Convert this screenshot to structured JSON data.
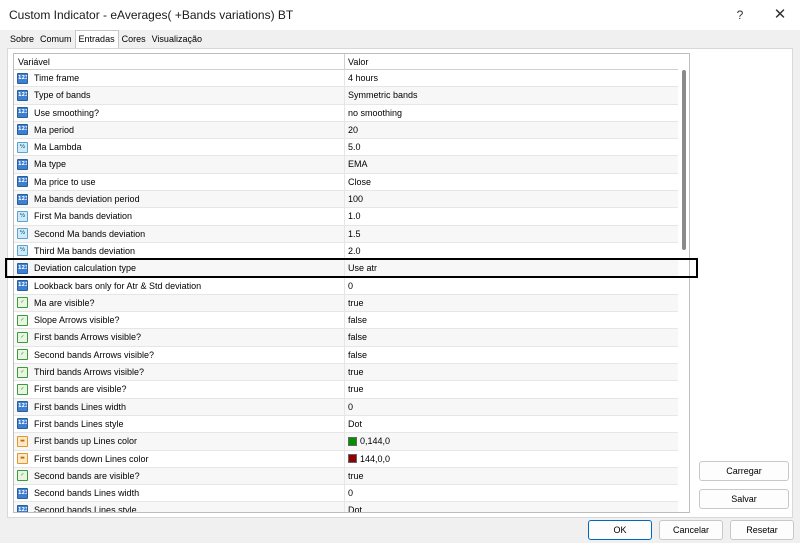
{
  "window": {
    "title": "Custom Indicator - eAverages( +Bands variations) BT",
    "help_label": "?",
    "close_label": "✕"
  },
  "tabs": [
    {
      "label": "Sobre",
      "active": false
    },
    {
      "label": "Comum",
      "active": false
    },
    {
      "label": "Entradas",
      "active": true
    },
    {
      "label": "Cores",
      "active": false
    },
    {
      "label": "Visualização",
      "active": false
    }
  ],
  "grid": {
    "col_variable": "Variável",
    "col_value": "Valor",
    "rows": [
      {
        "type": "int",
        "icon": "123",
        "name": "Time frame",
        "value": "4 hours"
      },
      {
        "type": "int",
        "icon": "123",
        "name": "Type of bands",
        "value": "Symmetric bands"
      },
      {
        "type": "int",
        "icon": "123",
        "name": "Use smoothing?",
        "value": "no smoothing"
      },
      {
        "type": "int",
        "icon": "123",
        "name": "Ma period",
        "value": "20"
      },
      {
        "type": "dbl",
        "icon": "½",
        "name": "Ma Lambda",
        "value": "5.0"
      },
      {
        "type": "int",
        "icon": "123",
        "name": "Ma type",
        "value": "EMA"
      },
      {
        "type": "int",
        "icon": "123",
        "name": "Ma price to use",
        "value": "Close"
      },
      {
        "type": "int",
        "icon": "123",
        "name": "Ma  bands deviation period",
        "value": "100"
      },
      {
        "type": "dbl",
        "icon": "½",
        "name": "First Ma bands deviation",
        "value": "1.0"
      },
      {
        "type": "dbl",
        "icon": "½",
        "name": "Second Ma bands deviation",
        "value": "1.5"
      },
      {
        "type": "dbl",
        "icon": "½",
        "name": "Third Ma bands deviation",
        "value": "2.0"
      },
      {
        "type": "int",
        "icon": "123",
        "name": "Deviation calculation type",
        "value": "Use atr"
      },
      {
        "type": "int",
        "icon": "123",
        "name": "Lookback bars only for Atr & Std deviation",
        "value": "0"
      },
      {
        "type": "bool",
        "icon": "✓",
        "name": "Ma are visible?",
        "value": "true"
      },
      {
        "type": "bool",
        "icon": "✓",
        "name": "Slope Arrows visible?",
        "value": "false"
      },
      {
        "type": "bool",
        "icon": "✓",
        "name": "First bands Arrows visible?",
        "value": "false"
      },
      {
        "type": "bool",
        "icon": "✓",
        "name": "Second bands Arrows visible?",
        "value": "false"
      },
      {
        "type": "bool",
        "icon": "✓",
        "name": "Third bands Arrows visible?",
        "value": "true"
      },
      {
        "type": "bool",
        "icon": "✓",
        "name": "First bands are visible?",
        "value": "true"
      },
      {
        "type": "int",
        "icon": "123",
        "name": "First bands Lines width",
        "value": "0"
      },
      {
        "type": "int",
        "icon": "123",
        "name": "First bands Lines style",
        "value": "Dot"
      },
      {
        "type": "color",
        "icon": "▬",
        "name": "First bands up Lines color",
        "value": "0,144,0",
        "swatch": "#009000"
      },
      {
        "type": "color",
        "icon": "▬",
        "name": "First bands down Lines color",
        "value": "144,0,0",
        "swatch": "#900000"
      },
      {
        "type": "bool",
        "icon": "✓",
        "name": "Second bands are visible?",
        "value": "true"
      },
      {
        "type": "int",
        "icon": "123",
        "name": "Second bands Lines width",
        "value": "0"
      },
      {
        "type": "int",
        "icon": "123",
        "name": "Second bands Lines style",
        "value": "Dot"
      }
    ]
  },
  "side_buttons": {
    "load": "Carregar",
    "save": "Salvar"
  },
  "bottom_buttons": {
    "ok": "OK",
    "cancel": "Cancelar",
    "reset": "Resetar"
  }
}
